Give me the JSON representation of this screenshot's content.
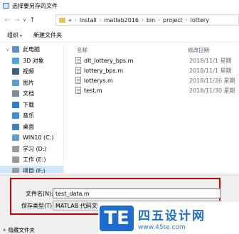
{
  "window": {
    "title": "选择要另存的文件"
  },
  "nav": {
    "breadcrumb": [
      "«",
      "Install",
      "matlab2016",
      "bin",
      "project",
      "lottery"
    ]
  },
  "toolbar": {
    "organize": "组织",
    "new_folder": "新建文件夹"
  },
  "sidebar": {
    "items": [
      {
        "label": "此电脑",
        "icon": "computer-icon",
        "color": "#5a8fd0"
      },
      {
        "label": "3D 对象",
        "icon": "3d-objects-icon",
        "color": "#4aa6e0"
      },
      {
        "label": "视频",
        "icon": "video-icon",
        "color": "#3a5f8a"
      },
      {
        "label": "图片",
        "icon": "pictures-icon",
        "color": "#5a9bd5"
      },
      {
        "label": "文档",
        "icon": "documents-icon",
        "color": "#7a8ca0"
      },
      {
        "label": "下载",
        "icon": "downloads-icon",
        "color": "#2a7bd8"
      },
      {
        "label": "音乐",
        "icon": "music-icon",
        "color": "#3a8fd8"
      },
      {
        "label": "桌面",
        "icon": "desktop-icon",
        "color": "#3a7fc8"
      },
      {
        "label": "WIN10 (C:)",
        "icon": "windows-drive-icon",
        "color": "#6a9ad0"
      },
      {
        "label": "学习 (D:)",
        "icon": "drive-icon",
        "color": "#9a9a9a"
      },
      {
        "label": "工作 (E:)",
        "icon": "drive-icon",
        "color": "#9a9a9a"
      },
      {
        "label": "项目 (F:)",
        "icon": "drive-icon",
        "color": "#9a9a9a"
      }
    ]
  },
  "filelist": {
    "columns": {
      "name": "名称",
      "modified": "修改日期"
    },
    "files": [
      {
        "name": "dlt_lottery_bps.m",
        "date": "2018/11/1 星期"
      },
      {
        "name": "lottery_bps.m",
        "date": "2018/11/1 星期"
      },
      {
        "name": "lotterys.m",
        "date": "2018/11/26 星期"
      },
      {
        "name": "test.m",
        "date": "2018/11/30 星期"
      }
    ]
  },
  "form": {
    "filename_label": "文件名(N):",
    "filename_value": "test_data.m",
    "filetype_label": "保存类型(T):",
    "filetype_value": "MATLAB 代码文件"
  },
  "footer": {
    "hide_folders": "隐藏文件夹"
  },
  "watermark": {
    "logo": "TE",
    "name": "四五设计网",
    "url": "www.45te.com"
  },
  "colors": {
    "highlight_border": "#d20000",
    "selected_bg": "#cce8ff",
    "brand_blue": "#1c6dd0"
  }
}
